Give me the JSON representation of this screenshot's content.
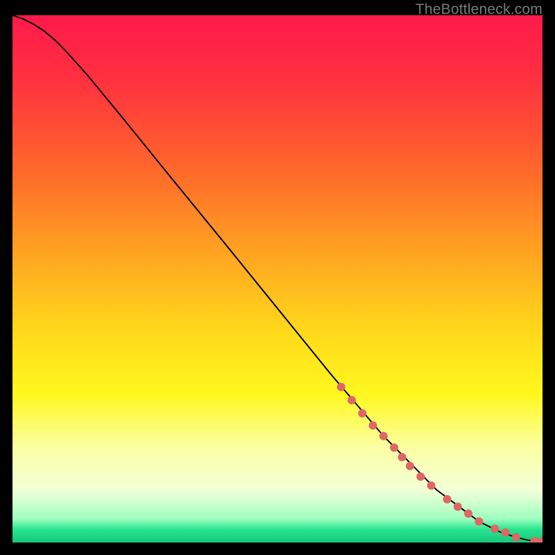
{
  "watermark": "TheBottleneck.com",
  "chart_data": {
    "type": "line",
    "title": "",
    "xlabel": "",
    "ylabel": "",
    "xlim": [
      0,
      100
    ],
    "ylim": [
      0,
      100
    ],
    "grid": false,
    "background_gradient": {
      "stops": [
        {
          "pos": 0.0,
          "color": "#ff1a4b"
        },
        {
          "pos": 0.12,
          "color": "#ff3040"
        },
        {
          "pos": 0.3,
          "color": "#ff6a2a"
        },
        {
          "pos": 0.45,
          "color": "#ffa321"
        },
        {
          "pos": 0.6,
          "color": "#ffd91a"
        },
        {
          "pos": 0.72,
          "color": "#fff81f"
        },
        {
          "pos": 0.82,
          "color": "#fbffa3"
        },
        {
          "pos": 0.9,
          "color": "#f3ffd8"
        },
        {
          "pos": 0.955,
          "color": "#9fffc0"
        },
        {
          "pos": 0.975,
          "color": "#28e58f"
        },
        {
          "pos": 1.0,
          "color": "#14c87a"
        }
      ]
    },
    "series": [
      {
        "name": "curve",
        "type": "line",
        "color": "#000000",
        "x": [
          0,
          2,
          4,
          6,
          8,
          10,
          14,
          20,
          30,
          40,
          50,
          60,
          70,
          80,
          88,
          92,
          95,
          97,
          98.5,
          100
        ],
        "y": [
          100,
          99.3,
          98.3,
          97.0,
          95.3,
          93.3,
          88.8,
          81.5,
          69.1,
          56.8,
          44.4,
          32.0,
          20.2,
          10.0,
          4.0,
          2.0,
          1.0,
          0.5,
          0.3,
          0.3
        ]
      },
      {
        "name": "highlight-points",
        "type": "scatter",
        "color": "#e06666",
        "radius": 6,
        "x": [
          62,
          64,
          66,
          68,
          70,
          72,
          73.5,
          75,
          77,
          79,
          82,
          84,
          86,
          88,
          91,
          93,
          95,
          98.5,
          100
        ],
        "y": [
          29.5,
          27.0,
          24.5,
          22.2,
          20.2,
          18.0,
          16.2,
          14.5,
          12.5,
          10.8,
          8.2,
          6.8,
          5.5,
          4.0,
          2.6,
          1.9,
          1.0,
          0.3,
          0.3
        ]
      }
    ]
  }
}
